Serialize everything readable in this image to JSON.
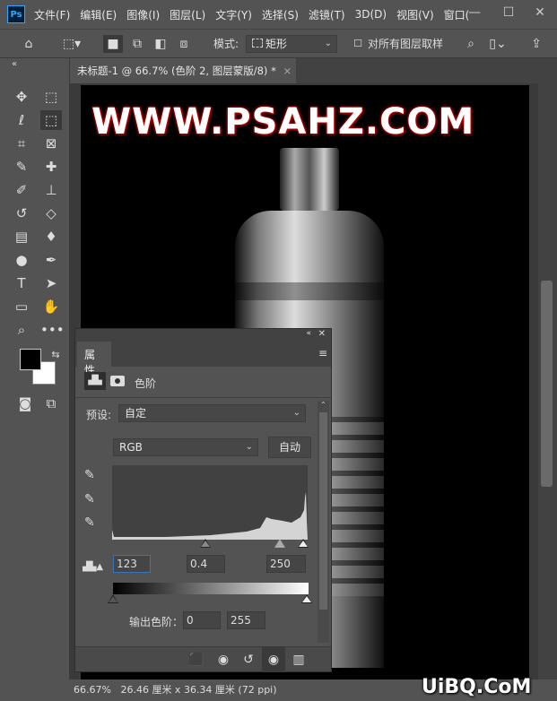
{
  "app": {
    "logo": "Ps",
    "menus": [
      "文件(F)",
      "编辑(E)",
      "图像(I)",
      "图层(L)",
      "文字(Y)",
      "选择(S)",
      "滤镜(T)",
      "3D(D)",
      "视图(V)",
      "窗口("
    ],
    "window_controls": [
      "—",
      "☐",
      "✕"
    ]
  },
  "options": {
    "mode_label": "模式:",
    "mode_value": "矩形",
    "sample_all_label": "对所有图层取样",
    "sample_all_checked": false
  },
  "document_tab": {
    "title": "未标题-1 @ 66.7% (色阶 2, 图层蒙版/8) *",
    "close": "×"
  },
  "canvas": {
    "watermark_text": "WWW.PSAHZ.COM"
  },
  "status": {
    "zoom": "66.67%",
    "info": "26.46 厘米 x 36.34 厘米 (72 ppi)"
  },
  "panel": {
    "tab": "属性",
    "adjustment_name": "色阶",
    "preset_label": "预设:",
    "preset_value": "自定",
    "channel": "RGB",
    "auto_button": "自动",
    "input_black": "123",
    "input_gamma": "0.4",
    "input_white": "250",
    "output_label": "输出色阶：",
    "output_black": "0",
    "output_white": "255"
  },
  "corner_watermark": "UiBQ.CoM"
}
